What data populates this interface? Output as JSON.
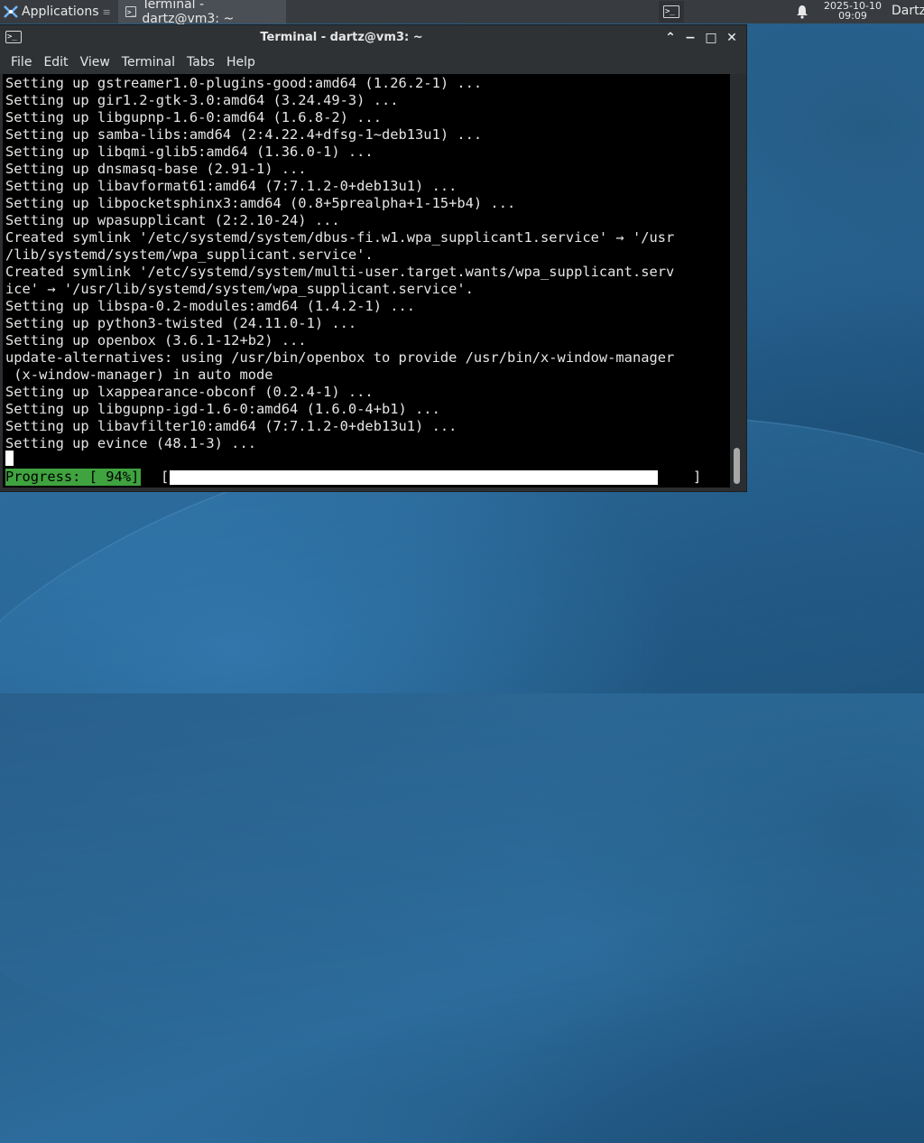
{
  "panel": {
    "applications_label": "Applications",
    "task_title": "Terminal - dartz@vm3: ~",
    "clock_date": "2025-10-10",
    "clock_time": "09:09",
    "user": "Dartz"
  },
  "window": {
    "title": "Terminal - dartz@vm3: ~",
    "menu": [
      "File",
      "Edit",
      "View",
      "Terminal",
      "Tabs",
      "Help"
    ],
    "buttons": {
      "shade": "⌃",
      "minimize": "−",
      "maximize": "□",
      "close": "✕"
    }
  },
  "terminal": {
    "lines": [
      "Setting up gstreamer1.0-plugins-good:amd64 (1.26.2-1) ...",
      "Setting up gir1.2-gtk-3.0:amd64 (3.24.49-3) ...",
      "Setting up libgupnp-1.6-0:amd64 (1.6.8-2) ...",
      "Setting up samba-libs:amd64 (2:4.22.4+dfsg-1~deb13u1) ...",
      "Setting up libqmi-glib5:amd64 (1.36.0-1) ...",
      "Setting up dnsmasq-base (2.91-1) ...",
      "Setting up libavformat61:amd64 (7:7.1.2-0+deb13u1) ...",
      "Setting up libpocketsphinx3:amd64 (0.8+5prealpha+1-15+b4) ...",
      "Setting up wpasupplicant (2:2.10-24) ...",
      "Created symlink '/etc/systemd/system/dbus-fi.w1.wpa_supplicant1.service' → '/usr",
      "/lib/systemd/system/wpa_supplicant.service'.",
      "Created symlink '/etc/systemd/system/multi-user.target.wants/wpa_supplicant.serv",
      "ice' → '/usr/lib/systemd/system/wpa_supplicant.service'.",
      "Setting up libspa-0.2-modules:amd64 (1.4.2-1) ...",
      "Setting up python3-twisted (24.11.0-1) ...",
      "Setting up openbox (3.6.1-12+b2) ...",
      "update-alternatives: using /usr/bin/openbox to provide /usr/bin/x-window-manager",
      " (x-window-manager) in auto mode",
      "Setting up lxappearance-obconf (0.2.4-1) ...",
      "Setting up libgupnp-igd-1.6-0:amd64 (1.6.0-4+b1) ...",
      "Setting up libavfilter10:amd64 (7:7.1.2-0+deb13u1) ...",
      "Setting up evince (48.1-3) ..."
    ],
    "progress_label": "Progress: [ 94%]",
    "progress_open": "[",
    "progress_close": "]",
    "progress_fraction": 0.94
  },
  "colors": {
    "progress_label_bg": "#3fa33f",
    "terminal_bg": "#000000",
    "panel_bg": "#383c40"
  }
}
